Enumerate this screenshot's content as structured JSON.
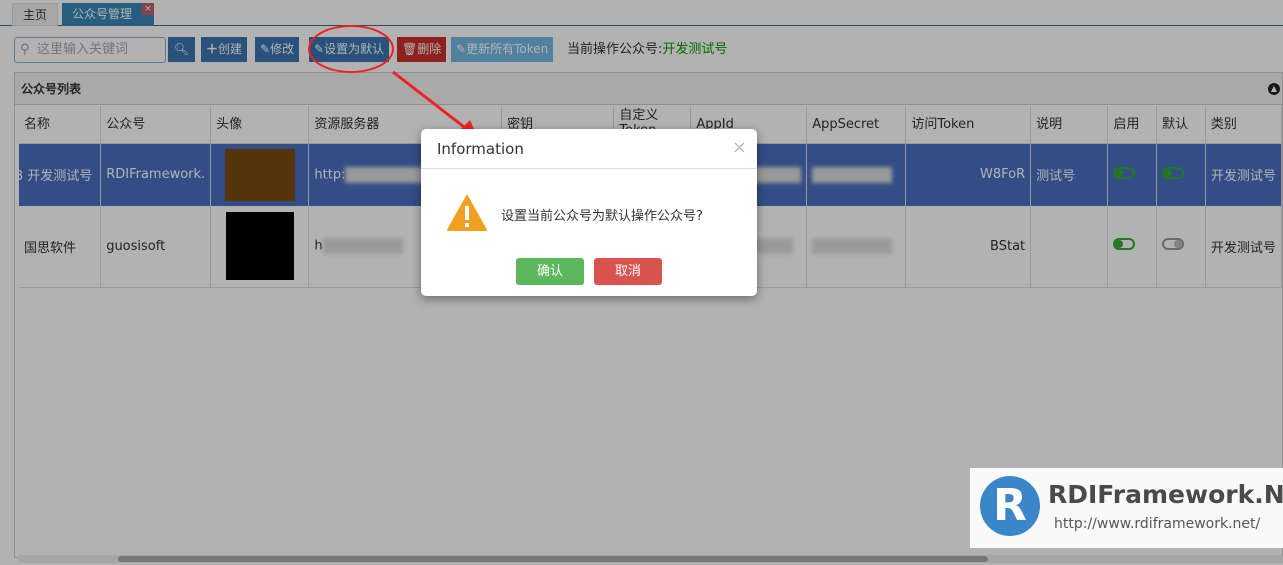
{
  "tabs": [
    {
      "label": "主页"
    },
    {
      "label": "公众号管理",
      "close": "×"
    }
  ],
  "toolbar": {
    "search_placeholder": "这里输入关键词",
    "search_icon": "search-icon",
    "create": "创建",
    "edit": "修改",
    "set_default": "设置为默认",
    "delete": "删除",
    "update_token": "更新所有Token",
    "current_label": "当前操作公众号:",
    "current_value": "开发测试号"
  },
  "panel": {
    "title": "公众号列表"
  },
  "columns": [
    "名称",
    "公众号",
    "头像",
    "资源服务器",
    "密钥",
    "自定义Token",
    "AppId",
    "AppSecret",
    "访问Token",
    "说明",
    "启用",
    "默认",
    "类别"
  ],
  "rows": [
    {
      "num": "3",
      "name": "开发测试号",
      "account": "RDIFramework.",
      "server": "http:",
      "appid": "b01",
      "token": "W8FoR",
      "desc": "测试号",
      "enabled": true,
      "default": true,
      "category": "开发测试号"
    },
    {
      "name": "国思软件",
      "account": "guosisoft",
      "server": "h",
      "appid": "99",
      "token": "BStat",
      "desc": "",
      "enabled": true,
      "default": false,
      "category": "开发测试号"
    }
  ],
  "dialog": {
    "title": "Information",
    "message": "设置当前公众号为默认操作公众号?",
    "ok": "确认",
    "cancel": "取消",
    "close": "×"
  },
  "watermark": {
    "brand": "RDIFramework.NET",
    "url": "http://www.rdiframework.net/",
    "logo": "R"
  },
  "colors": {
    "primary": "#3a75b0",
    "danger": "#c9302c",
    "success": "#5cb85c",
    "selected_row": "#4a6fc0",
    "annotation": "#ee2222"
  }
}
